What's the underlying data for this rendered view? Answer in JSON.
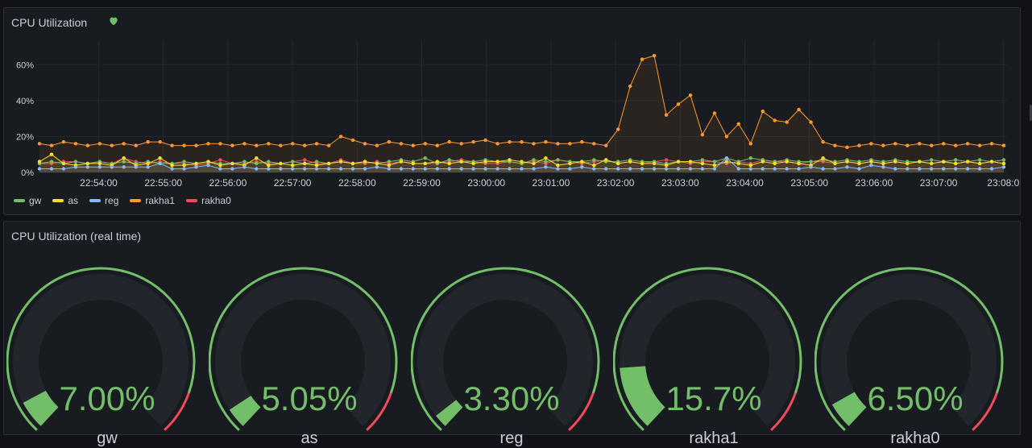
{
  "panel1": {
    "title": "CPU Utilization",
    "health_icon": "heart-icon",
    "health_color": "#73bf69"
  },
  "chart_data": {
    "type": "line",
    "title": "CPU Utilization",
    "xlabel": "",
    "ylabel": "",
    "ylim": [
      0,
      70
    ],
    "grid": true,
    "legend_position": "bottom-left",
    "y_ticks": [
      "0%",
      "20%",
      "40%",
      "60%"
    ],
    "x_ticks": [
      "22:54:00",
      "22:55:00",
      "22:56:00",
      "22:57:00",
      "22:58:00",
      "22:59:00",
      "23:00:00",
      "23:01:00",
      "23:02:00",
      "23:03:00",
      "23:04:00",
      "23:05:00",
      "23:06:00",
      "23:07:00",
      "23:08:0"
    ],
    "x_start": "22:53:25",
    "x_step_seconds": 15,
    "series": [
      {
        "name": "gw",
        "color": "#73bf69",
        "values": [
          5,
          6,
          5,
          6,
          5,
          6,
          5,
          6,
          5,
          6,
          5,
          5,
          6,
          5,
          6,
          5,
          5,
          6,
          5,
          6,
          5,
          6,
          5,
          6,
          5,
          6,
          5,
          6,
          5,
          6,
          7,
          6,
          8,
          5,
          7,
          6,
          6,
          7,
          6,
          6,
          5,
          7,
          6,
          7,
          6,
          6,
          7,
          6,
          6,
          7,
          6,
          6,
          5,
          6,
          6,
          7,
          6,
          8,
          6,
          8,
          7,
          6,
          7,
          6,
          6,
          7,
          6,
          7,
          6,
          7,
          6,
          7,
          6,
          6,
          7,
          6,
          7,
          6,
          7,
          6,
          7
        ]
      },
      {
        "name": "as",
        "color": "#fade2a",
        "values": [
          6,
          10,
          5,
          4,
          5,
          5,
          4,
          8,
          4,
          5,
          8,
          4,
          4,
          5,
          6,
          4,
          5,
          4,
          8,
          4,
          5,
          4,
          5,
          4,
          5,
          6,
          5,
          6,
          5,
          4,
          6,
          5,
          5,
          6,
          5,
          6,
          5,
          6,
          6,
          7,
          6,
          5,
          8,
          4,
          5,
          6,
          4,
          7,
          5,
          6,
          5,
          5,
          4,
          6,
          6,
          5,
          4,
          6,
          5,
          4,
          6,
          5,
          6,
          5,
          4,
          8,
          5,
          6,
          5,
          6,
          5,
          6,
          5,
          6,
          5,
          6,
          5,
          6,
          5,
          6,
          5
        ]
      },
      {
        "name": "reg",
        "color": "#8ab8ff",
        "values": [
          2,
          2,
          2,
          3,
          3,
          3,
          3,
          3,
          3,
          3,
          5,
          2,
          2,
          3,
          4,
          2,
          2,
          3,
          2,
          2,
          2,
          2,
          2,
          2,
          2,
          2,
          2,
          2,
          3,
          2,
          2,
          2,
          2,
          2,
          2,
          2,
          2,
          2,
          2,
          2,
          2,
          2,
          3,
          2,
          2,
          3,
          2,
          2,
          2,
          2,
          2,
          2,
          2,
          2,
          2,
          2,
          2,
          8,
          2,
          2,
          2,
          2,
          2,
          2,
          3,
          2,
          2,
          3,
          2,
          4,
          3,
          2,
          2,
          2,
          2,
          2,
          2,
          2,
          2,
          2,
          3
        ]
      },
      {
        "name": "rakha1",
        "color": "#ff9830",
        "values": [
          16,
          15,
          17,
          16,
          15,
          16,
          15,
          16,
          15,
          17,
          17,
          15,
          15,
          15,
          16,
          16,
          15,
          16,
          15,
          16,
          15,
          16,
          15,
          16,
          15,
          20,
          18,
          16,
          15,
          17,
          16,
          15,
          16,
          15,
          17,
          16,
          17,
          18,
          16,
          17,
          17,
          16,
          17,
          16,
          16,
          17,
          16,
          15,
          24,
          48,
          63,
          65,
          32,
          38,
          43,
          21,
          33,
          20,
          27,
          16,
          34,
          29,
          28,
          35,
          28,
          17,
          15,
          14,
          15,
          16,
          15,
          16,
          15,
          16,
          15,
          16,
          15,
          16,
          15,
          16,
          15
        ]
      },
      {
        "name": "rakha0",
        "color": "#f2495c",
        "values": [
          5,
          5,
          6,
          6,
          5,
          6,
          5,
          8,
          6,
          5,
          6,
          5,
          5,
          4,
          5,
          7,
          5,
          5,
          6,
          5,
          5,
          6,
          7,
          5,
          5,
          7,
          5,
          5,
          6,
          5,
          6,
          5,
          5,
          5,
          6,
          7,
          6,
          5,
          5,
          6,
          5,
          6,
          5,
          7,
          6,
          5,
          6,
          7,
          5,
          6,
          5,
          6,
          7,
          6,
          5,
          6,
          6,
          5,
          6,
          5,
          7,
          6,
          6,
          5,
          6,
          6,
          5,
          6,
          5,
          6,
          5,
          6,
          5,
          6,
          5,
          6,
          5,
          6,
          5,
          6,
          5
        ]
      }
    ]
  },
  "panel2": {
    "title": "CPU Utilization (real time)",
    "gauges": [
      {
        "name": "gw",
        "value_text": "7.00%",
        "value": 7.0
      },
      {
        "name": "as",
        "value_text": "5.05%",
        "value": 5.05
      },
      {
        "name": "reg",
        "value_text": "3.30%",
        "value": 3.3
      },
      {
        "name": "rakha1",
        "value_text": "15.7%",
        "value": 15.7
      },
      {
        "name": "rakha0",
        "value_text": "6.50%",
        "value": 6.5
      }
    ],
    "gauge_max": 100,
    "threshold_red_start": 90,
    "colors": {
      "good": "#73bf69",
      "bad": "#f2495c",
      "track": "#22252b"
    }
  }
}
